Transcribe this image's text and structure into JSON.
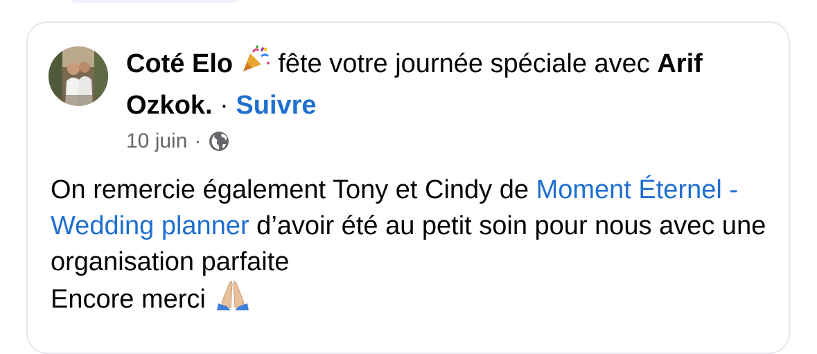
{
  "post": {
    "author": "Coté Elo",
    "celebrating_icon": "party-popper-icon",
    "action_text": " fête votre journée spéciale avec ",
    "tagged_person": "Arif Ozkok.",
    "separator": " · ",
    "follow_label": "Suivre",
    "date": "10 juin",
    "meta_separator": "·",
    "audience_icon": "globe-icon",
    "body": {
      "line1_text": "On remercie également Tony et Cindy de ",
      "link_text": "Moment Éternel - Wedding planner",
      "line2_text": " d’avoir été au petit soin pour nous avec une organisation parfaite",
      "line3_text": "Encore merci ",
      "emoji_icon": "folded-hands-icon"
    }
  },
  "colors": {
    "link": "#1f6fd0",
    "meta": "#65676b",
    "text": "#050505",
    "card_border": "#e4e6eb"
  }
}
